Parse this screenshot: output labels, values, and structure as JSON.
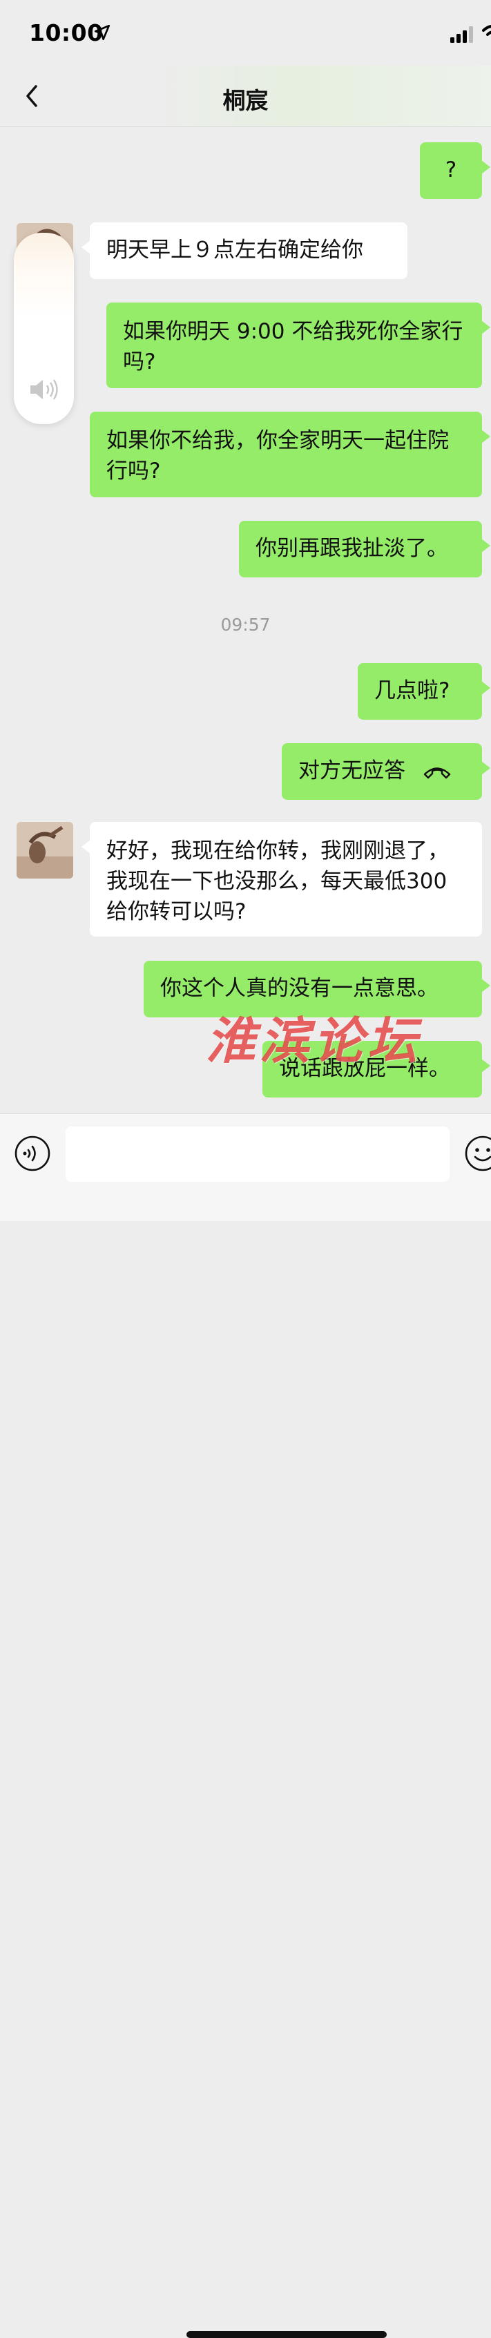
{
  "status_bar": {
    "time": "10:00"
  },
  "header": {
    "title": "桐宸"
  },
  "messages": [
    {
      "sender": "me",
      "text": "?"
    },
    {
      "sender": "contact",
      "text": "明天早上９点左右确定给你"
    },
    {
      "sender": "me",
      "text": "如果你明天 9:00 不给我死你全家行吗?"
    },
    {
      "sender": "me",
      "text": "如果你不给我，你全家明天一起住院行吗?"
    },
    {
      "sender": "me",
      "text": "你别再跟我扯淡了。"
    },
    {
      "sender": "system",
      "text": "09:57"
    },
    {
      "sender": "me",
      "text": "几点啦?"
    },
    {
      "sender": "me",
      "text": "对方无应答"
    },
    {
      "sender": "contact",
      "text": "好好，我现在给你转，我刚刚退了，我现在一下也没那么，每天最低300给你转可以吗?"
    },
    {
      "sender": "me",
      "text": "你这个人真的没有一点意思。"
    },
    {
      "sender": "me",
      "text": "说话跟放屁一样。"
    }
  ],
  "watermark": {
    "text": "淮滨论坛"
  },
  "input_bar": {
    "value": ""
  },
  "colors": {
    "outgoing_bubble": "#95ec69",
    "incoming_bubble": "#ffffff",
    "background": "#ededed",
    "watermark": "#e03434"
  },
  "icons": {
    "location": "location-arrow-icon",
    "signal": "cellular-signal-icon",
    "wifi": "wifi-icon",
    "back": "chevron-left-icon",
    "speaker": "speaker-volume-icon",
    "hangup": "phone-hangup-icon",
    "voice": "voice-input-icon",
    "emoji": "emoji-face-icon"
  }
}
